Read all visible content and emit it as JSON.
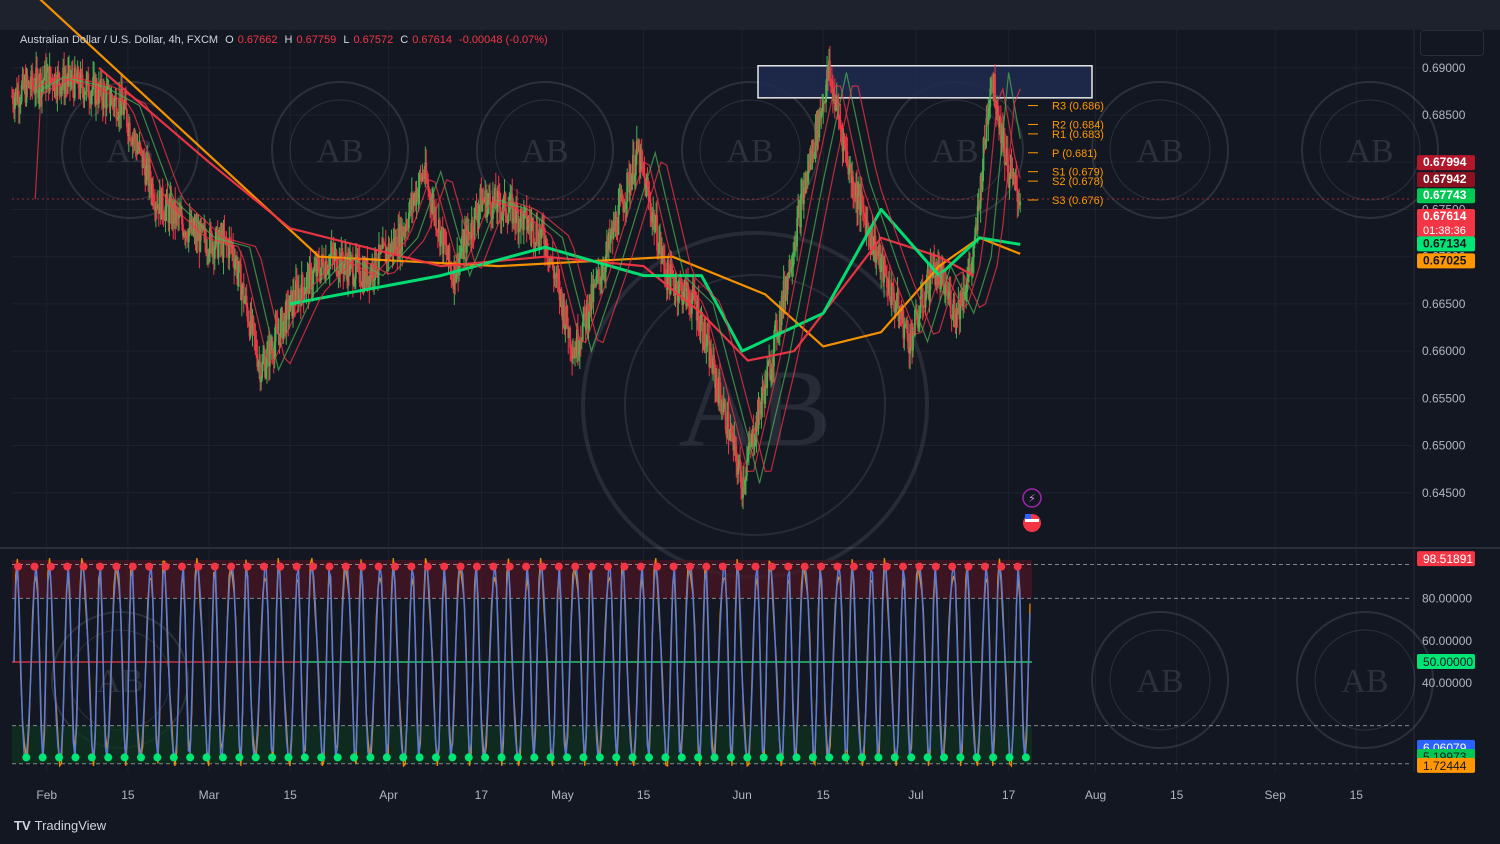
{
  "header": {
    "symbol": "Australian Dollar / U.S. Dollar, 4h, FXCM",
    "open_label": "O",
    "open": "0.67662",
    "high_label": "H",
    "high": "0.67759",
    "low_label": "L",
    "low": "0.67572",
    "close_label": "C",
    "close": "0.67614",
    "change": "-0.00048 (-0.07%)"
  },
  "branding": {
    "logo_text": "TradingView"
  },
  "colors": {
    "background": "#131722",
    "grid": "#1e222d",
    "axis_text": "#b2b5be",
    "up": "#4caf50",
    "down": "#f23645",
    "orange": "#ff9800",
    "lime": "#00e676",
    "blue_osc": "#5b7bd5",
    "box": "#ffffff"
  },
  "chart_data": [
    {
      "type": "candlestick",
      "title": "Australian Dollar / U.S. Dollar, 4h, FXCM",
      "x_ticks": [
        "Feb",
        "15",
        "Mar",
        "15",
        "Apr",
        "17",
        "May",
        "15",
        "Jun",
        "15",
        "Jul",
        "17",
        "Aug",
        "15",
        "Sep",
        "15"
      ],
      "y_ticks": [
        "0.69000",
        "0.68500",
        "0.68000",
        "0.67500",
        "0.67000",
        "0.66500",
        "0.66000",
        "0.65500",
        "0.65000",
        "0.64500"
      ],
      "ylim": [
        0.64,
        0.694
      ],
      "price_path": [
        {
          "t": "Jan 26",
          "p": 0.687
        },
        {
          "t": "Feb 1",
          "p": 0.689
        },
        {
          "t": "Feb 8",
          "p": 0.688
        },
        {
          "t": "Feb 14",
          "p": 0.686
        },
        {
          "t": "Feb 20",
          "p": 0.676
        },
        {
          "t": "Feb 27",
          "p": 0.672
        },
        {
          "t": "Mar 5",
          "p": 0.671
        },
        {
          "t": "Mar 10",
          "p": 0.658
        },
        {
          "t": "Mar 16",
          "p": 0.666
        },
        {
          "t": "Mar 22",
          "p": 0.67
        },
        {
          "t": "Mar 28",
          "p": 0.668
        },
        {
          "t": "Apr 3",
          "p": 0.672
        },
        {
          "t": "Apr 7",
          "p": 0.679
        },
        {
          "t": "Apr 12",
          "p": 0.668
        },
        {
          "t": "Apr 17",
          "p": 0.676
        },
        {
          "t": "Apr 22",
          "p": 0.675
        },
        {
          "t": "Apr 28",
          "p": 0.672
        },
        {
          "t": "May 3",
          "p": 0.66
        },
        {
          "t": "May 8",
          "p": 0.669
        },
        {
          "t": "May 14",
          "p": 0.681
        },
        {
          "t": "May 19",
          "p": 0.668
        },
        {
          "t": "May 24",
          "p": 0.665
        },
        {
          "t": "May 30",
          "p": 0.651
        },
        {
          "t": "Jun 1",
          "p": 0.646
        },
        {
          "t": "Jun 6",
          "p": 0.659
        },
        {
          "t": "Jun 12",
          "p": 0.678
        },
        {
          "t": "Jun 16",
          "p": 0.6895
        },
        {
          "t": "Jun 20",
          "p": 0.678
        },
        {
          "t": "Jun 25",
          "p": 0.669
        },
        {
          "t": "Jun 30",
          "p": 0.661
        },
        {
          "t": "Jul 4",
          "p": 0.669
        },
        {
          "t": "Jul 8",
          "p": 0.664
        },
        {
          "t": "Jul 11",
          "p": 0.67
        },
        {
          "t": "Jul 14",
          "p": 0.6895
        },
        {
          "t": "Jul 17",
          "p": 0.679
        },
        {
          "t": "Jul 19",
          "p": 0.6761
        }
      ],
      "moving_averages": [
        {
          "name": "",
          "color": "#ff9800",
          "path": [
            [
              "Jan 26",
              0.7
            ],
            [
              "Mar 20",
              0.67
            ],
            [
              "Apr 20",
              0.669
            ],
            [
              "May 20",
              0.67
            ],
            [
              "Jun 5",
              0.666
            ],
            [
              "Jun 15",
              0.6605
            ],
            [
              "Jun 25",
              0.662
            ],
            [
              "Jul 5",
              0.669
            ],
            [
              "Jul 12",
              0.672
            ],
            [
              "Jul 19",
              0.6703
            ]
          ]
        },
        {
          "name": "",
          "color": "#f23645",
          "path": [
            [
              "Feb 10",
              0.69
            ],
            [
              "Mar 1",
              0.68
            ],
            [
              "Mar 15",
              0.673
            ],
            [
              "Apr 10",
              0.669
            ],
            [
              "Apr 28",
              0.67
            ],
            [
              "May 15",
              0.669
            ],
            [
              "May 25",
              0.664
            ],
            [
              "Jun 2",
              0.659
            ],
            [
              "Jun 10",
              0.66
            ],
            [
              "Jun 25",
              0.672
            ],
            [
              "Jul 5",
              0.67
            ],
            [
              "Jul 11",
              0.668
            ]
          ]
        },
        {
          "name": "",
          "color": "#00e676",
          "path": [
            [
              "Mar 15",
              0.665
            ],
            [
              "Apr 10",
              0.668
            ],
            [
              "Apr 28",
              0.671
            ],
            [
              "May 15",
              0.668
            ],
            [
              "May 25",
              0.668
            ],
            [
              "Jun 1",
              0.66
            ],
            [
              "Jun 15",
              0.664
            ],
            [
              "Jun 25",
              0.675
            ],
            [
              "Jul 5",
              0.668
            ],
            [
              "Jul 12",
              0.672
            ],
            [
              "Jul 19",
              0.6713
            ]
          ]
        }
      ],
      "pivot_levels": [
        {
          "label": "R3 (0.686)",
          "value": 0.686
        },
        {
          "label": "R2 (0.684)",
          "value": 0.684
        },
        {
          "label": "R1 (0.683)",
          "value": 0.683
        },
        {
          "label": "P (0.681)",
          "value": 0.681
        },
        {
          "label": "S1 (0.679)",
          "value": 0.679
        },
        {
          "label": "S2 (0.678)",
          "value": 0.678
        },
        {
          "label": "S3 (0.676)",
          "value": 0.676
        }
      ],
      "resistance_zone": {
        "from": "Jun 1",
        "to": "Jul 19",
        "low": 0.6883,
        "high": 0.69
      },
      "price_labels": [
        {
          "value": "0.67994",
          "bg": "#b2172a",
          "y": 0.6799
        },
        {
          "value": "0.67942",
          "bg": "#8b1220",
          "y": 0.6781
        },
        {
          "value": "0.67743",
          "bg": "#00c853",
          "y": 0.6764
        },
        {
          "value": "0.67614",
          "extra": "01:38:36",
          "bg": "#f23645",
          "y": 0.6742
        },
        {
          "value": "0.67134",
          "bg": "#00e676",
          "y": 0.6713
        },
        {
          "value": "0.67025",
          "bg": "#ff9800",
          "y": 0.6695
        }
      ]
    },
    {
      "type": "line",
      "title": "",
      "y_ticks": [
        "80.00000",
        "60.00000",
        "40.00000"
      ],
      "ylim": [
        0,
        100
      ],
      "overbought": 80,
      "oversold": 20,
      "midline": 50,
      "osc_path_note": "stochastic oscillating between ~2 and ~98",
      "series": [
        {
          "name": "",
          "color": "#5b7bd5",
          "cycles": 62
        },
        {
          "name": "",
          "color": "#ff9800",
          "cycles": 62
        }
      ],
      "value_labels": [
        {
          "value": "98.51891",
          "bg": "#f23645",
          "y": 98.5
        },
        {
          "value": "50.00000",
          "bg": "#00e676",
          "y": 50
        },
        {
          "value": "6.06079",
          "bg": "#2962ff",
          "y": 9.5
        },
        {
          "value": "5.19973",
          "bg": "#00c853",
          "y": 5.2
        },
        {
          "value": "1.72444",
          "bg": "#ff9800",
          "y": 1.0
        }
      ]
    }
  ]
}
